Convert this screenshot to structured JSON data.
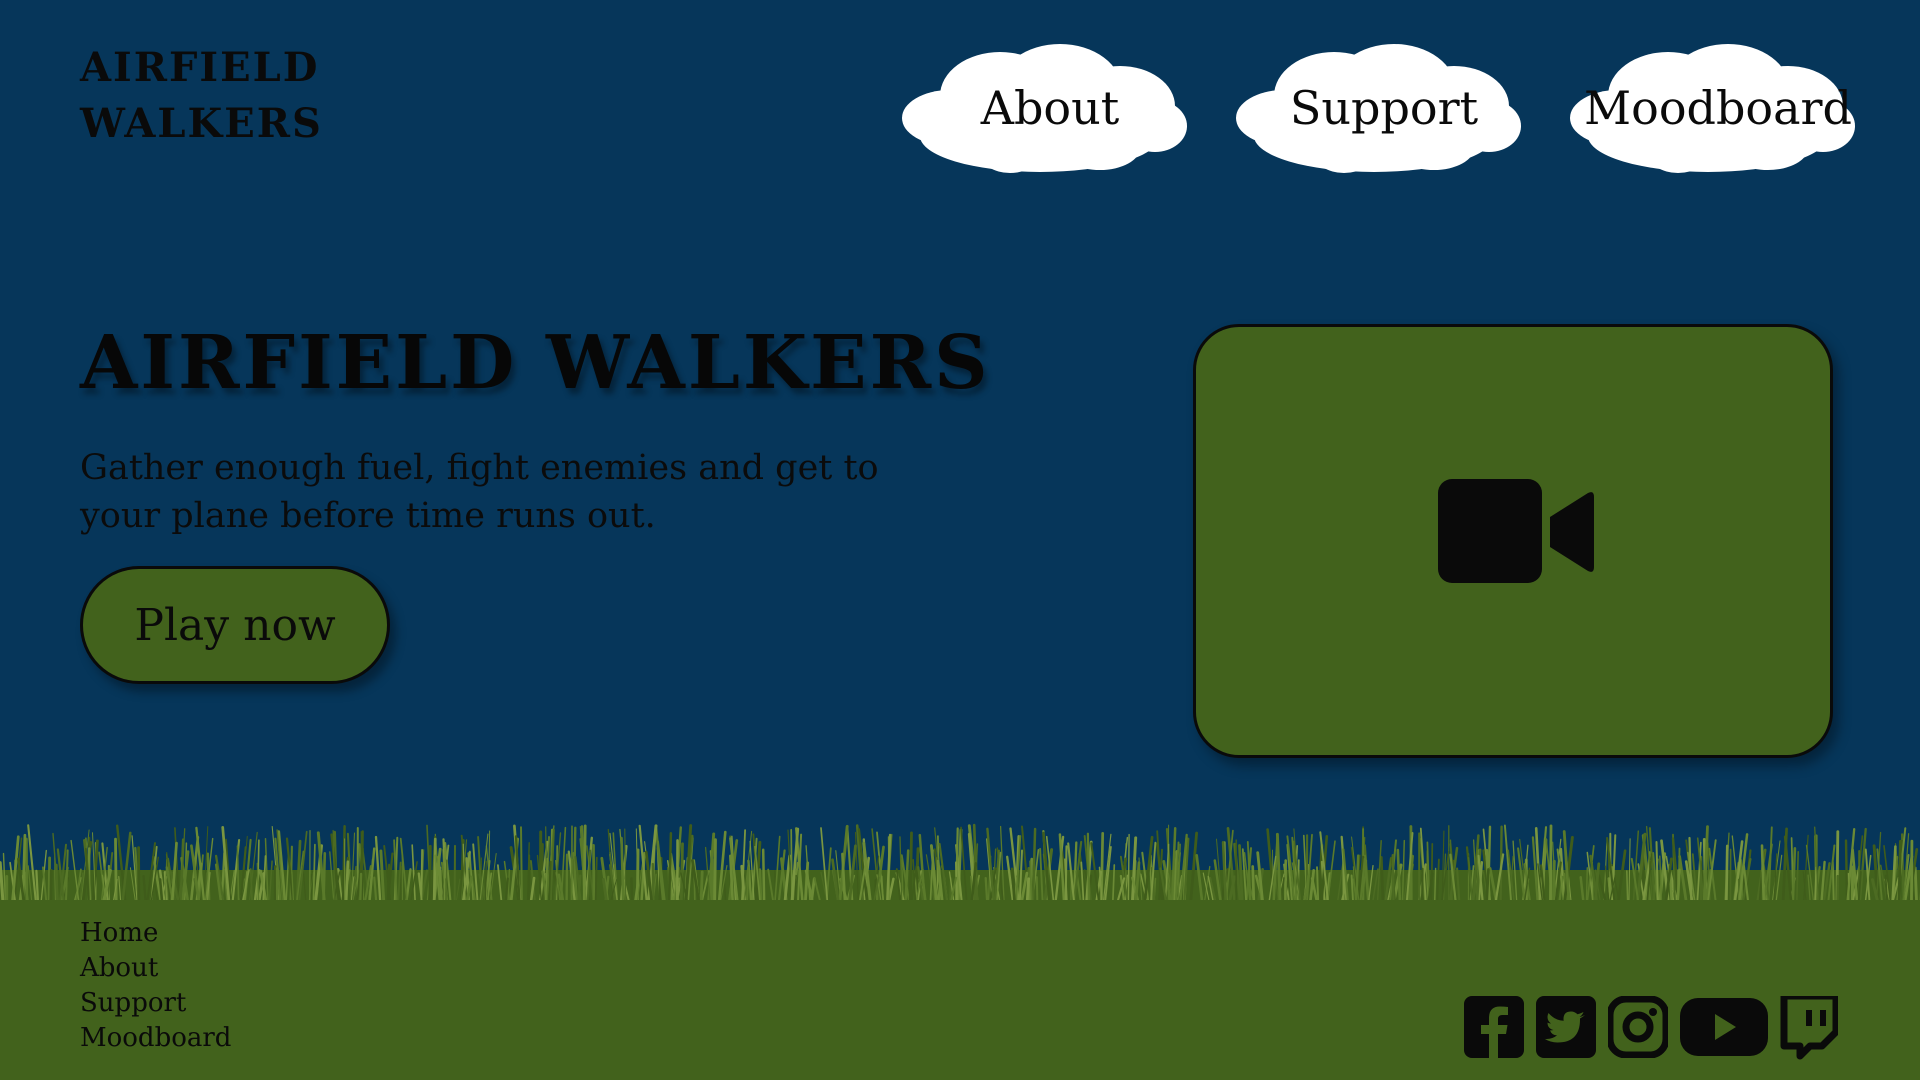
{
  "site": {
    "logo_line1": "AIRFIELD",
    "logo_line2": "WALKERS"
  },
  "nav": {
    "items": [
      {
        "label": "About"
      },
      {
        "label": "Support"
      },
      {
        "label": "Moodboard"
      }
    ]
  },
  "hero": {
    "title": "AIRFIELD WALKERS",
    "description": "Gather enough fuel, fight enemies and get to your plane before time runs out.",
    "play_button": "Play now"
  },
  "video": {
    "icon": "video-camera-icon"
  },
  "footer": {
    "links": [
      {
        "label": "Home"
      },
      {
        "label": "About"
      },
      {
        "label": "Support"
      },
      {
        "label": "Moodboard"
      }
    ],
    "socials": [
      {
        "icon": "facebook-icon"
      },
      {
        "icon": "twitter-icon"
      },
      {
        "icon": "instagram-icon"
      },
      {
        "icon": "youtube-icon"
      },
      {
        "icon": "twitch-icon"
      }
    ]
  },
  "colors": {
    "sky": "#06365a",
    "ground": "#42621c",
    "cloud": "#ffffff",
    "ink": "#0a0a0a"
  }
}
